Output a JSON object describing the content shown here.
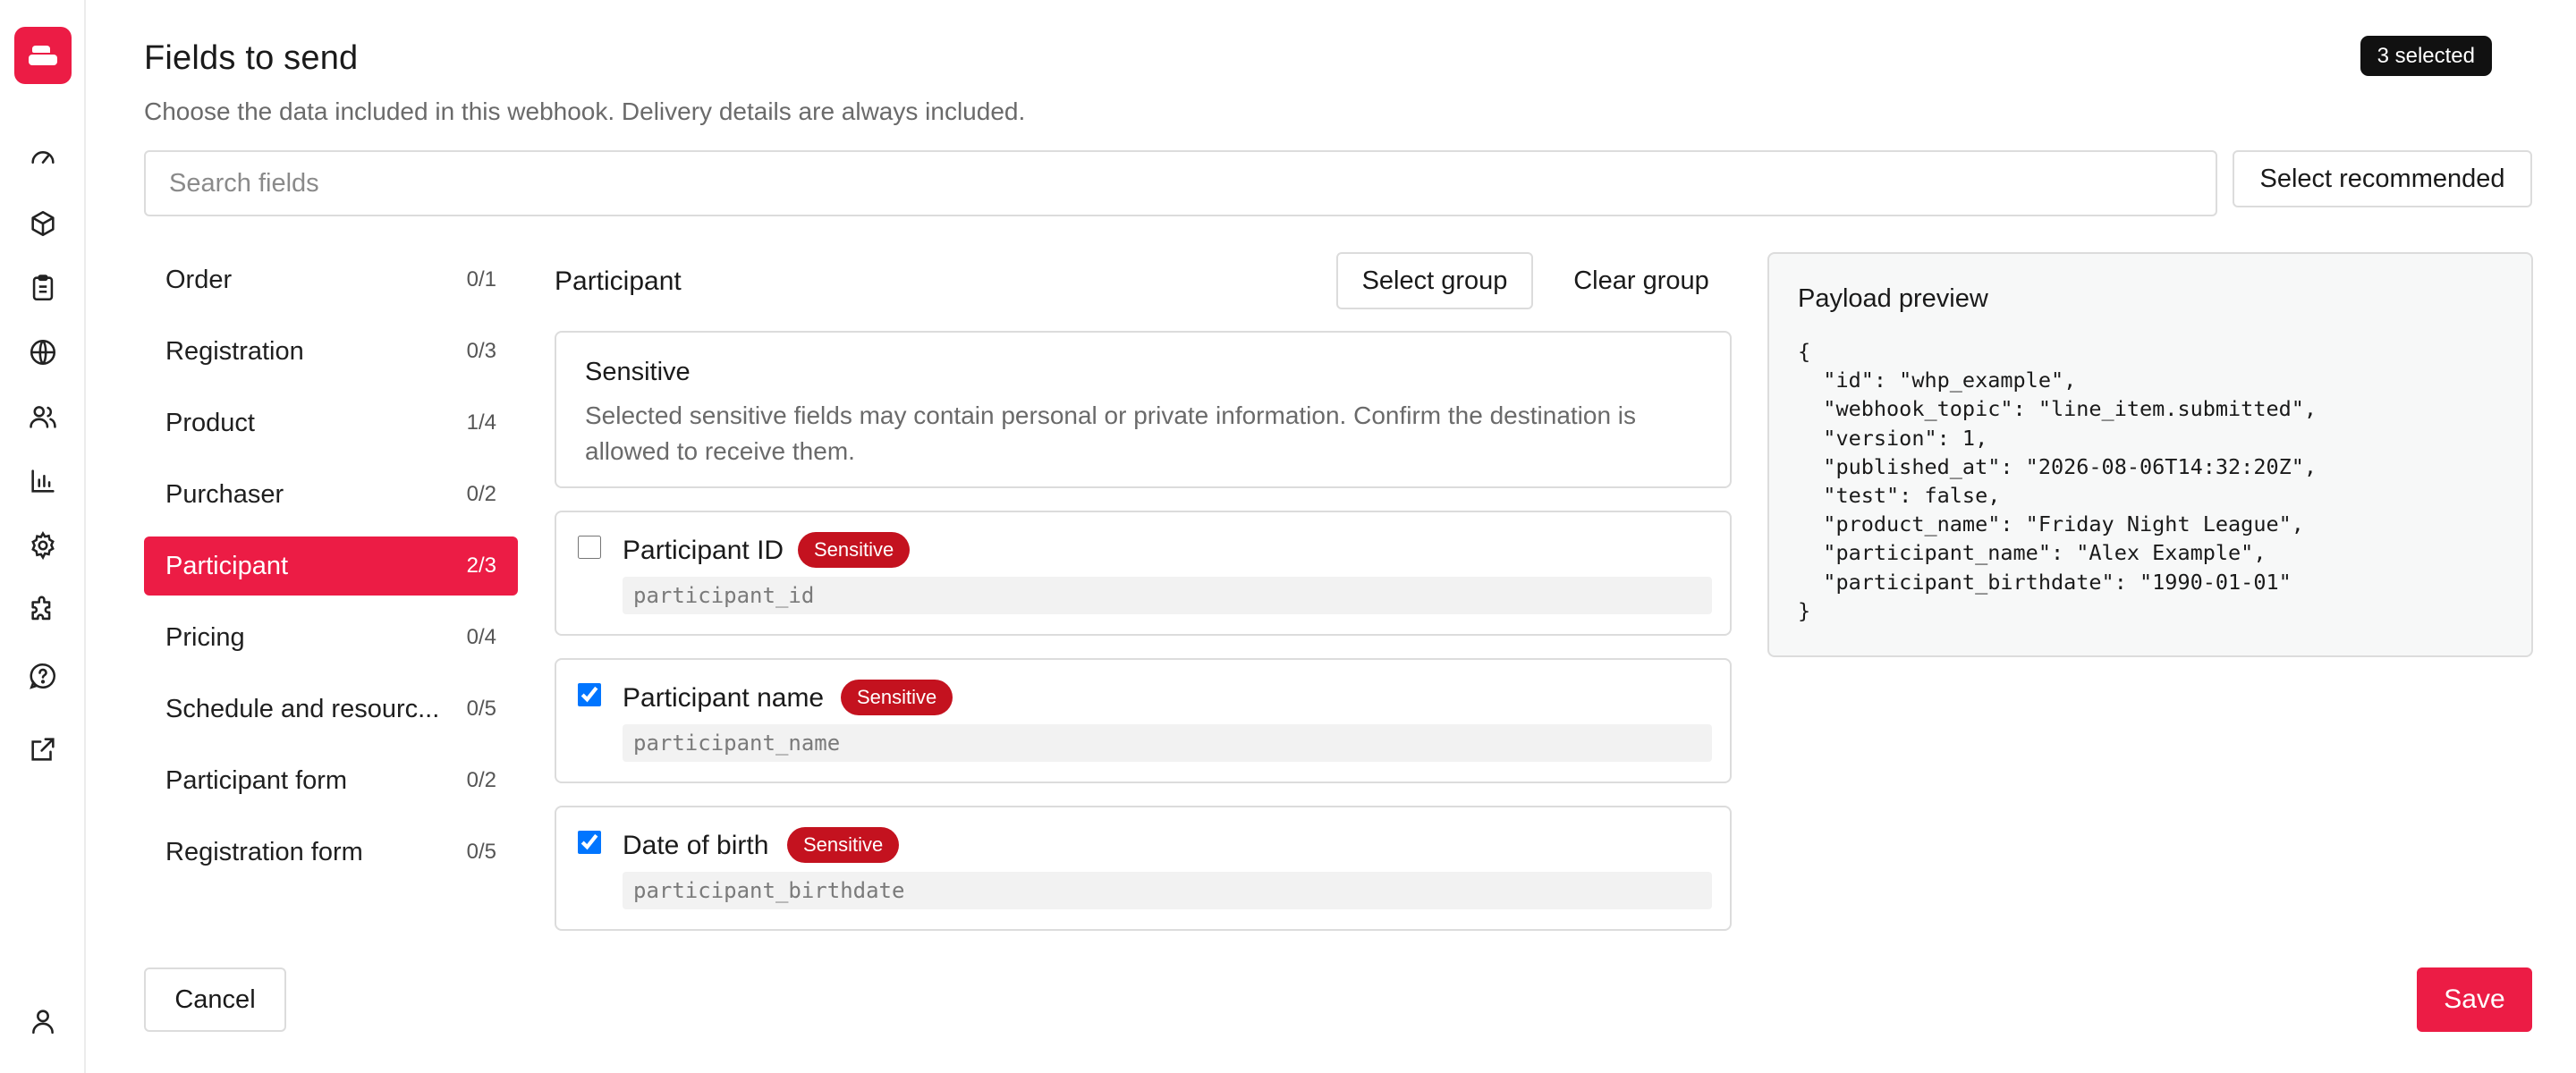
{
  "rail": {
    "logo": "logo-icon",
    "icons": [
      "gauge-icon",
      "box-icon",
      "clipboard-icon",
      "globe-icon",
      "users-icon",
      "bar-chart-icon",
      "gear-icon",
      "puzzle-icon",
      "help-icon",
      "external-link-icon"
    ],
    "bottom_icon": "user-icon",
    "accent": "#ec1c45"
  },
  "header": {
    "title": "Fields to send",
    "subtitle": "Choose the data included in this webhook. Delivery details are always included.",
    "selected_badge": "3 selected"
  },
  "search": {
    "placeholder": "Search fields",
    "value": ""
  },
  "select_recommended_label": "Select recommended",
  "groups": [
    {
      "label": "Order",
      "count": "0/1",
      "active": false
    },
    {
      "label": "Registration",
      "count": "0/3",
      "active": false
    },
    {
      "label": "Product",
      "count": "1/4",
      "active": false
    },
    {
      "label": "Purchaser",
      "count": "0/2",
      "active": false
    },
    {
      "label": "Participant",
      "count": "2/3",
      "active": true
    },
    {
      "label": "Pricing",
      "count": "0/4",
      "active": false
    },
    {
      "label": "Schedule and resourc...",
      "count": "0/5",
      "active": false
    },
    {
      "label": "Participant form",
      "count": "0/2",
      "active": false
    },
    {
      "label": "Registration form",
      "count": "0/5",
      "active": false
    }
  ],
  "group_panel": {
    "title": "Participant",
    "select_group_label": "Select group",
    "clear_group_label": "Clear group",
    "sensitive_notice": {
      "heading": "Sensitive",
      "text": "Selected sensitive fields may contain personal or private information. Confirm the destination is allowed to receive them."
    },
    "fields": [
      {
        "label": "Participant ID",
        "badge": "Sensitive",
        "key": "participant_id",
        "checked": false
      },
      {
        "label": "Participant name",
        "badge": "Sensitive",
        "key": "participant_name",
        "checked": true
      },
      {
        "label": "Date of birth",
        "badge": "Sensitive",
        "key": "participant_birthdate",
        "checked": true
      }
    ]
  },
  "preview": {
    "title": "Payload preview",
    "lines": [
      "{",
      "  \"id\": \"whp_example\",",
      "  \"webhook_topic\": \"line_item.submitted\",",
      "  \"version\": 1,",
      "  \"published_at\": \"2026-08-06T14:32:20Z\",",
      "  \"test\": false,",
      "  \"product_name\": \"Friday Night League\",",
      "  \"participant_name\": \"Alex Example\",",
      "  \"participant_birthdate\": \"1990-01-01\"",
      "}"
    ]
  },
  "footer": {
    "cancel_label": "Cancel",
    "save_label": "Save"
  }
}
